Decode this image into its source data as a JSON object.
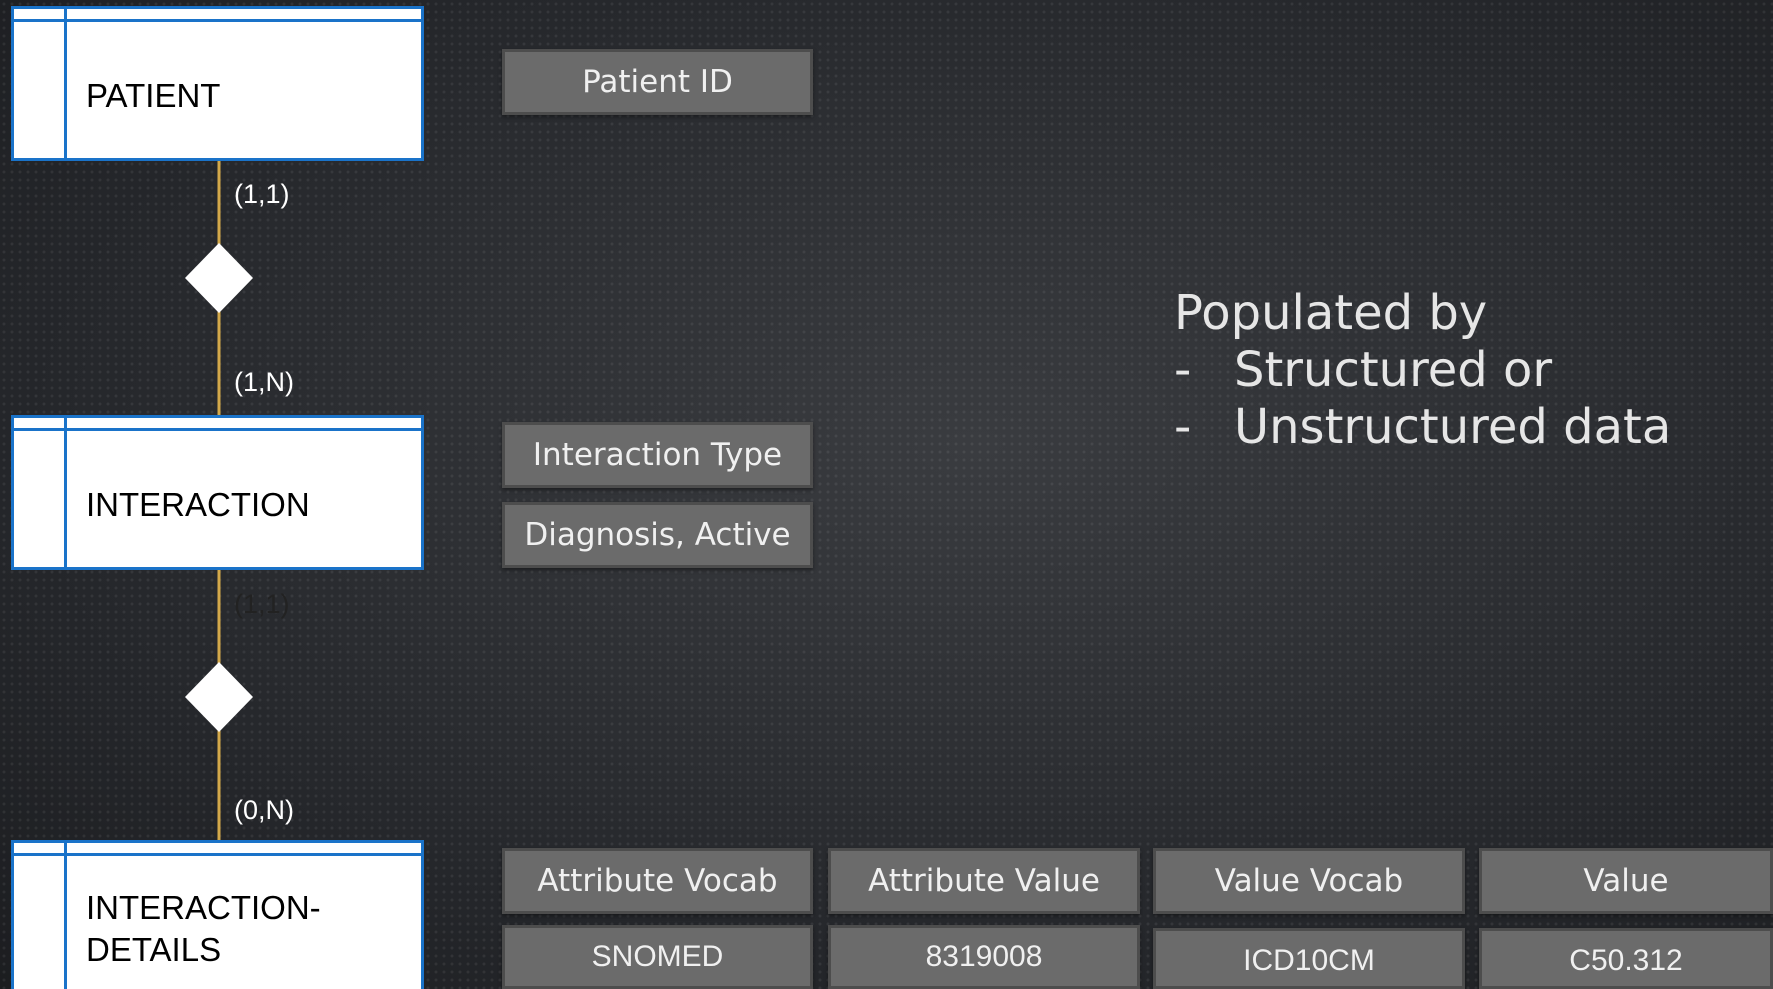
{
  "entities": {
    "patient": "PATIENT",
    "interaction": "INTERACTION",
    "interaction_details_line1": "INTERACTION-",
    "interaction_details_line2": "DETAILS"
  },
  "cardinalities": {
    "patient_rel1": "(1,1)",
    "interaction_rel1": "(1,N)",
    "interaction_rel2": "(1,1)",
    "details_rel2": "(0,N)"
  },
  "attributes": {
    "patient_id": "Patient ID",
    "interaction_type": "Interaction Type",
    "interaction_value": "Diagnosis, Active"
  },
  "details_table": {
    "headers": [
      "Attribute Vocab",
      "Attribute Value",
      "Value Vocab",
      "Value"
    ],
    "row": [
      "SNOMED",
      "8319008",
      "ICD10CM",
      "C50.312"
    ]
  },
  "note": {
    "title": "Populated by",
    "items": [
      "Structured or",
      "Unstructured data"
    ]
  },
  "colors": {
    "entity_border": "#1a73c9",
    "connector_line": "#d4a94a",
    "card_fill": "#6b6b6b"
  }
}
